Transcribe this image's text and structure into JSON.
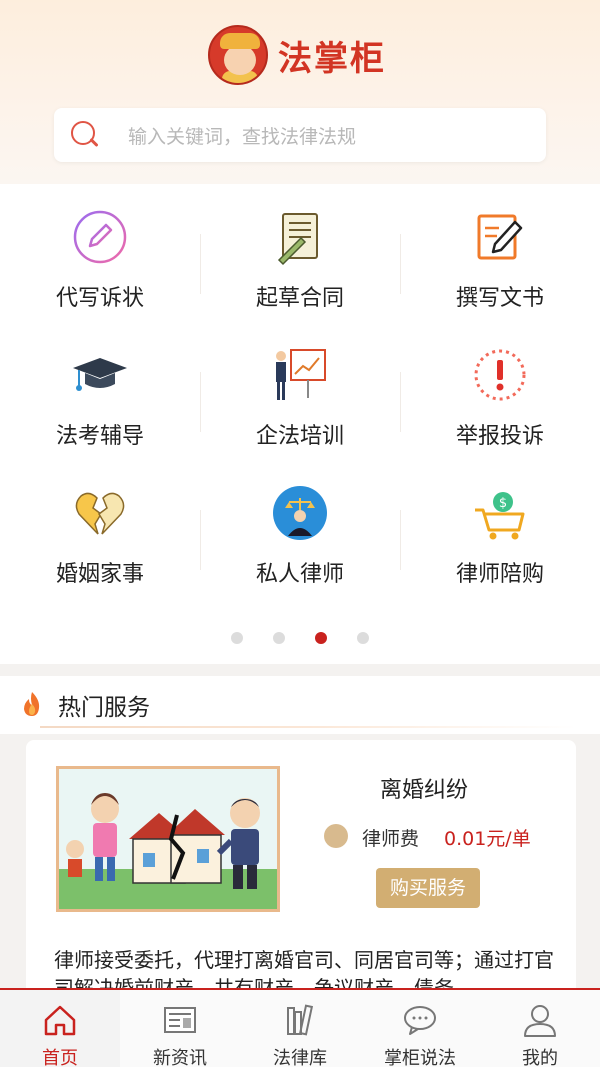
{
  "brand": {
    "name": "法掌柜",
    "accent": "#d23423"
  },
  "search": {
    "placeholder": "输入关键词，查找法律法规"
  },
  "services": [
    {
      "label": "代写诉状",
      "icon": "pen-circle-icon"
    },
    {
      "label": "起草合同",
      "icon": "contract-icon"
    },
    {
      "label": "撰写文书",
      "icon": "document-pen-icon"
    },
    {
      "label": "法考辅导",
      "icon": "graduation-cap-icon"
    },
    {
      "label": "企法培训",
      "icon": "presentation-board-icon"
    },
    {
      "label": "举报投诉",
      "icon": "alert-icon"
    },
    {
      "label": "婚姻家事",
      "icon": "broken-heart-icon"
    },
    {
      "label": "私人律师",
      "icon": "lawyer-icon"
    },
    {
      "label": "律师陪购",
      "icon": "shopping-cart-icon"
    }
  ],
  "pager": {
    "count": 4,
    "active_index": 2
  },
  "hot": {
    "title": "热门服务",
    "card": {
      "title": "离婚纠纷",
      "fee_label": "律师费",
      "fee_value": "0.01元/单",
      "buy_label": "购买服务",
      "description": "律师接受委托，代理打离婚官司、同居官司等；通过打官司解决婚前财产、共有财产、争议财产、债务"
    }
  },
  "tabs": [
    {
      "label": "首页",
      "icon": "home-icon",
      "active": true
    },
    {
      "label": "新资讯",
      "icon": "newspaper-icon",
      "active": false
    },
    {
      "label": "法律库",
      "icon": "books-icon",
      "active": false
    },
    {
      "label": "掌柜说法",
      "icon": "chat-bubble-icon",
      "active": false
    },
    {
      "label": "我的",
      "icon": "user-icon",
      "active": false
    }
  ]
}
